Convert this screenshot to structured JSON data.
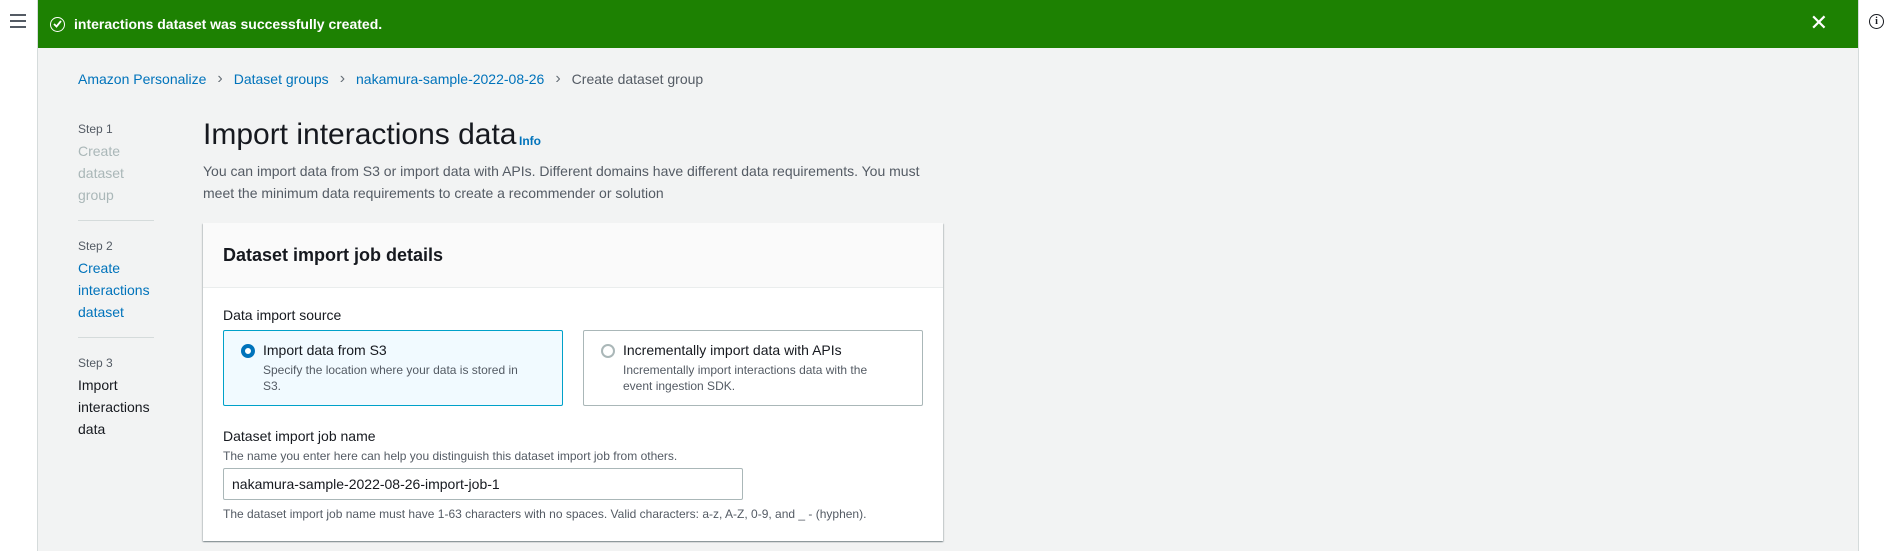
{
  "flash": {
    "message": "interactions dataset was successfully created.",
    "close_glyph": "✕",
    "color": "#1d8102"
  },
  "breadcrumb": [
    {
      "label": "Amazon Personalize"
    },
    {
      "label": "Dataset groups"
    },
    {
      "label": "nakamura-sample-2022-08-26"
    },
    {
      "label": "Create dataset group"
    }
  ],
  "steps": [
    {
      "num": "Step 1",
      "name": "Create dataset group",
      "state": "done"
    },
    {
      "num": "Step 2",
      "name": "Create interactions dataset",
      "state": "link"
    },
    {
      "num": "Step 3",
      "name": "Import interactions data",
      "state": "current"
    }
  ],
  "page": {
    "title": "Import interactions data",
    "info": "Info",
    "description": "You can import data from S3 or import data with APIs. Different domains have different data requirements. You must meet the minimum data requirements to create a recommender or solution"
  },
  "panel": {
    "heading": "Dataset import job details",
    "source_label": "Data import source",
    "options": [
      {
        "title": "Import data from S3",
        "subtitle": "Specify the location where your data is stored in S3.",
        "selected": true
      },
      {
        "title": "Incrementally import data with APIs",
        "subtitle": "Incrementally import interactions data with the event ingestion SDK.",
        "selected": false
      }
    ],
    "job_name_label": "Dataset import job name",
    "job_name_hint": "The name you enter here can help you distinguish this dataset import job from others.",
    "job_name_value": "nakamura-sample-2022-08-26-import-job-1",
    "job_name_constraint": "The dataset import job name must have 1-63 characters with no spaces. Valid characters: a-z, A-Z, 0-9, and _ - (hyphen)."
  },
  "icons": {
    "menu": "hamburger-icon",
    "info": "info-icon",
    "success": "check-circle-icon",
    "close": "close-icon",
    "breadcrumb_separator": "chevron-right-icon"
  },
  "colors": {
    "link": "#0073bb",
    "selected_tile_border": "#00a1c9",
    "selected_tile_bg": "#f1faff"
  }
}
